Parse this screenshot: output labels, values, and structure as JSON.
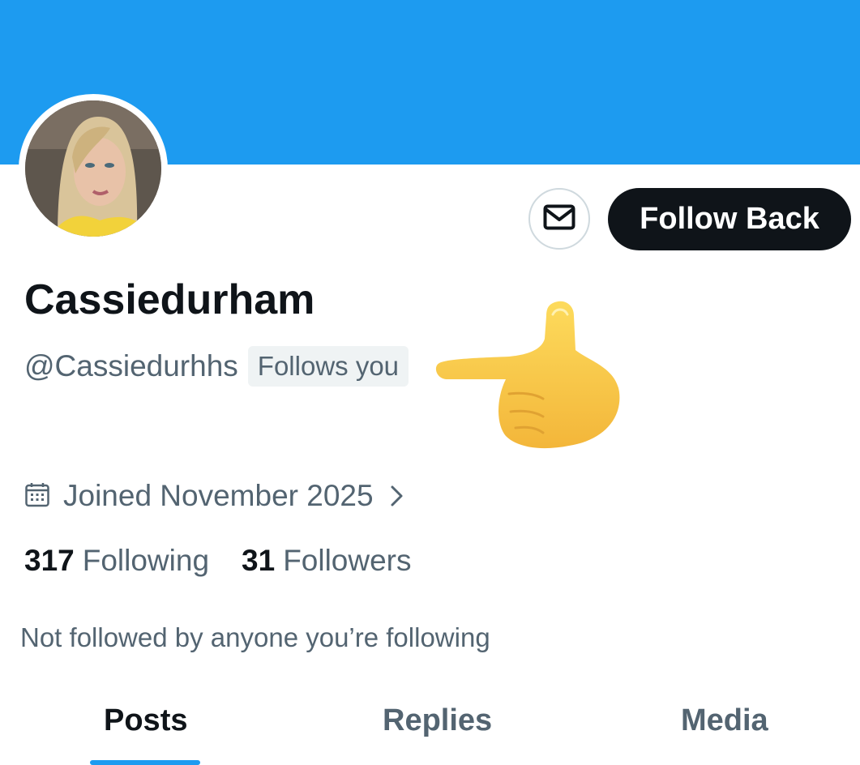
{
  "profile": {
    "display_name": "Cassiedurham",
    "handle": "@Cassiedurhhs",
    "follows_badge": "Follows you",
    "joined": "Joined November 2025",
    "following_count": "317",
    "following_label": "Following",
    "followers_count": "31",
    "followers_label": "Followers",
    "mutuals_text": "Not followed by anyone you’re following"
  },
  "actions": {
    "message_icon": "envelope-icon",
    "follow_label": "Follow Back"
  },
  "tabs": [
    {
      "label": "Posts",
      "active": true
    },
    {
      "label": "Replies",
      "active": false
    },
    {
      "label": "Media",
      "active": false
    }
  ],
  "overlay": {
    "icon": "pointing-left-hand-emoji"
  },
  "colors": {
    "banner": "#1d9bf0",
    "accent": "#1d9bf0",
    "primary_text": "#0f1419",
    "secondary_text": "#536471",
    "button_bg": "#0f1419"
  }
}
